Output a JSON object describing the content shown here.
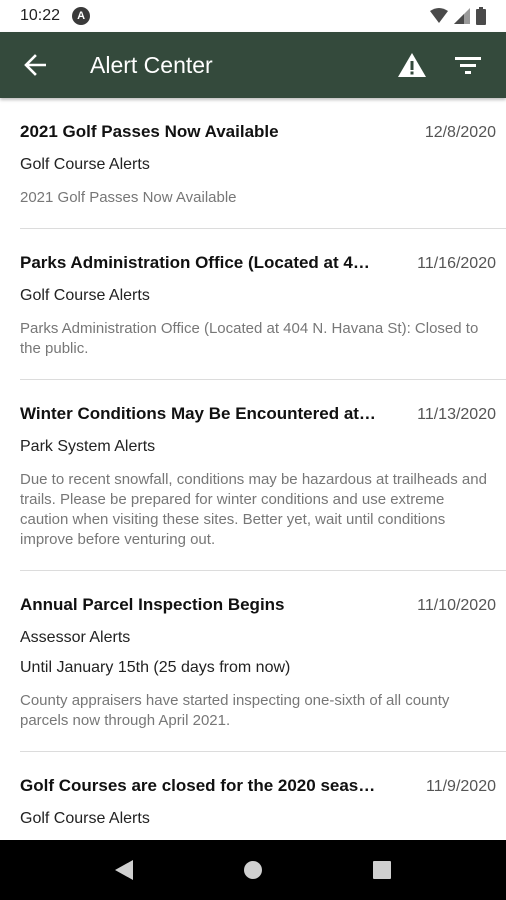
{
  "status_bar": {
    "time": "10:22",
    "app_badge": "A",
    "icons": [
      "wifi-icon",
      "signal-icon",
      "battery-icon"
    ]
  },
  "app_bar": {
    "title": "Alert Center",
    "background_color": "#344a3c",
    "actions": [
      "warning-icon",
      "filter-icon"
    ]
  },
  "alerts": [
    {
      "title": "2021 Golf Passes Now Available",
      "date": "12/8/2020",
      "category": "Golf Course Alerts",
      "extra": "",
      "body": "2021 Golf Passes Now Available"
    },
    {
      "title": "Parks Administration Office (Located at 4…",
      "date": "11/16/2020",
      "category": "Golf Course Alerts",
      "extra": "",
      "body": "Parks Administration Office (Located at 404 N. Havana St): Closed to the public."
    },
    {
      "title": "Winter Conditions May Be Encountered at…",
      "date": "11/13/2020",
      "category": "Park System Alerts",
      "extra": "",
      "body": "Due to recent snowfall, conditions may be hazardous at trailheads and trails. Please be prepared for winter conditions and use extreme caution when visiting these sites. Better yet, wait until conditions improve before venturing out."
    },
    {
      "title": "Annual Parcel Inspection Begins",
      "date": "11/10/2020",
      "category": "Assessor Alerts",
      "extra": "Until January 15th (25 days from now)",
      "body": "County appraisers have started inspecting one-sixth of all county parcels  now through April 2021."
    },
    {
      "title": "Golf Courses are closed for the 2020 seas…",
      "date": "11/9/2020",
      "category": "Golf Course Alerts",
      "extra": "",
      "body": ""
    }
  ],
  "nav_bar": {
    "buttons": [
      "back-triangle-icon",
      "home-circle-icon",
      "recents-square-icon"
    ]
  }
}
